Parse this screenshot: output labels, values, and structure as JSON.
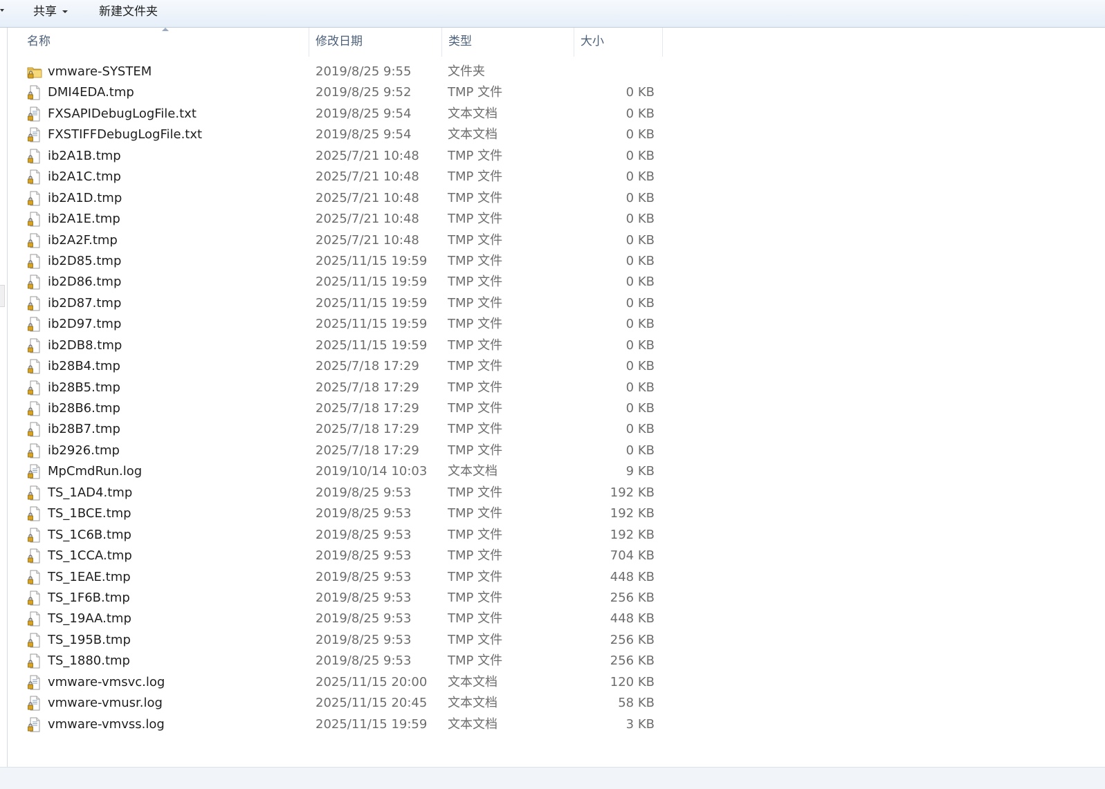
{
  "toolbar": {
    "share_label": "共享",
    "new_folder_label": "新建文件夹"
  },
  "columns": {
    "name": "名称",
    "date": "修改日期",
    "type": "类型",
    "size": "大小"
  },
  "files": [
    {
      "icon": "folder-locked-icon",
      "name": "vmware-SYSTEM",
      "date": "2019/8/25 9:55",
      "type": "文件夹",
      "size": ""
    },
    {
      "icon": "file-locked-icon",
      "name": "DMI4EDA.tmp",
      "date": "2019/8/25 9:52",
      "type": "TMP 文件",
      "size": "0 KB"
    },
    {
      "icon": "text-file-locked-icon",
      "name": "FXSAPIDebugLogFile.txt",
      "date": "2019/8/25 9:54",
      "type": "文本文档",
      "size": "0 KB"
    },
    {
      "icon": "text-file-locked-icon",
      "name": "FXSTIFFDebugLogFile.txt",
      "date": "2019/8/25 9:54",
      "type": "文本文档",
      "size": "0 KB"
    },
    {
      "icon": "file-locked-icon",
      "name": "ib2A1B.tmp",
      "date": "2025/7/21 10:48",
      "type": "TMP 文件",
      "size": "0 KB"
    },
    {
      "icon": "file-locked-icon",
      "name": "ib2A1C.tmp",
      "date": "2025/7/21 10:48",
      "type": "TMP 文件",
      "size": "0 KB"
    },
    {
      "icon": "file-locked-icon",
      "name": "ib2A1D.tmp",
      "date": "2025/7/21 10:48",
      "type": "TMP 文件",
      "size": "0 KB"
    },
    {
      "icon": "file-locked-icon",
      "name": "ib2A1E.tmp",
      "date": "2025/7/21 10:48",
      "type": "TMP 文件",
      "size": "0 KB"
    },
    {
      "icon": "file-locked-icon",
      "name": "ib2A2F.tmp",
      "date": "2025/7/21 10:48",
      "type": "TMP 文件",
      "size": "0 KB"
    },
    {
      "icon": "file-locked-icon",
      "name": "ib2D85.tmp",
      "date": "2025/11/15 19:59",
      "type": "TMP 文件",
      "size": "0 KB"
    },
    {
      "icon": "file-locked-icon",
      "name": "ib2D86.tmp",
      "date": "2025/11/15 19:59",
      "type": "TMP 文件",
      "size": "0 KB"
    },
    {
      "icon": "file-locked-icon",
      "name": "ib2D87.tmp",
      "date": "2025/11/15 19:59",
      "type": "TMP 文件",
      "size": "0 KB"
    },
    {
      "icon": "file-locked-icon",
      "name": "ib2D97.tmp",
      "date": "2025/11/15 19:59",
      "type": "TMP 文件",
      "size": "0 KB"
    },
    {
      "icon": "file-locked-icon",
      "name": "ib2DB8.tmp",
      "date": "2025/11/15 19:59",
      "type": "TMP 文件",
      "size": "0 KB"
    },
    {
      "icon": "file-locked-icon",
      "name": "ib28B4.tmp",
      "date": "2025/7/18 17:29",
      "type": "TMP 文件",
      "size": "0 KB"
    },
    {
      "icon": "file-locked-icon",
      "name": "ib28B5.tmp",
      "date": "2025/7/18 17:29",
      "type": "TMP 文件",
      "size": "0 KB"
    },
    {
      "icon": "file-locked-icon",
      "name": "ib28B6.tmp",
      "date": "2025/7/18 17:29",
      "type": "TMP 文件",
      "size": "0 KB"
    },
    {
      "icon": "file-locked-icon",
      "name": "ib28B7.tmp",
      "date": "2025/7/18 17:29",
      "type": "TMP 文件",
      "size": "0 KB"
    },
    {
      "icon": "file-locked-icon",
      "name": "ib2926.tmp",
      "date": "2025/7/18 17:29",
      "type": "TMP 文件",
      "size": "0 KB"
    },
    {
      "icon": "text-file-locked-icon",
      "name": "MpCmdRun.log",
      "date": "2019/10/14 10:03",
      "type": "文本文档",
      "size": "9 KB"
    },
    {
      "icon": "file-locked-icon",
      "name": "TS_1AD4.tmp",
      "date": "2019/8/25 9:53",
      "type": "TMP 文件",
      "size": "192 KB"
    },
    {
      "icon": "file-locked-icon",
      "name": "TS_1BCE.tmp",
      "date": "2019/8/25 9:53",
      "type": "TMP 文件",
      "size": "192 KB"
    },
    {
      "icon": "file-locked-icon",
      "name": "TS_1C6B.tmp",
      "date": "2019/8/25 9:53",
      "type": "TMP 文件",
      "size": "192 KB"
    },
    {
      "icon": "file-locked-icon",
      "name": "TS_1CCA.tmp",
      "date": "2019/8/25 9:53",
      "type": "TMP 文件",
      "size": "704 KB"
    },
    {
      "icon": "file-locked-icon",
      "name": "TS_1EAE.tmp",
      "date": "2019/8/25 9:53",
      "type": "TMP 文件",
      "size": "448 KB"
    },
    {
      "icon": "file-locked-icon",
      "name": "TS_1F6B.tmp",
      "date": "2019/8/25 9:53",
      "type": "TMP 文件",
      "size": "256 KB"
    },
    {
      "icon": "file-locked-icon",
      "name": "TS_19AA.tmp",
      "date": "2019/8/25 9:53",
      "type": "TMP 文件",
      "size": "448 KB"
    },
    {
      "icon": "file-locked-icon",
      "name": "TS_195B.tmp",
      "date": "2019/8/25 9:53",
      "type": "TMP 文件",
      "size": "256 KB"
    },
    {
      "icon": "file-locked-icon",
      "name": "TS_1880.tmp",
      "date": "2019/8/25 9:53",
      "type": "TMP 文件",
      "size": "256 KB"
    },
    {
      "icon": "text-file-locked-icon",
      "name": "vmware-vmsvc.log",
      "date": "2025/11/15 20:00",
      "type": "文本文档",
      "size": "120 KB"
    },
    {
      "icon": "text-file-locked-icon",
      "name": "vmware-vmusr.log",
      "date": "2025/11/15 20:45",
      "type": "文本文档",
      "size": "58 KB"
    },
    {
      "icon": "text-file-locked-icon",
      "name": "vmware-vmvss.log",
      "date": "2025/11/15 19:59",
      "type": "文本文档",
      "size": "3 KB"
    }
  ]
}
